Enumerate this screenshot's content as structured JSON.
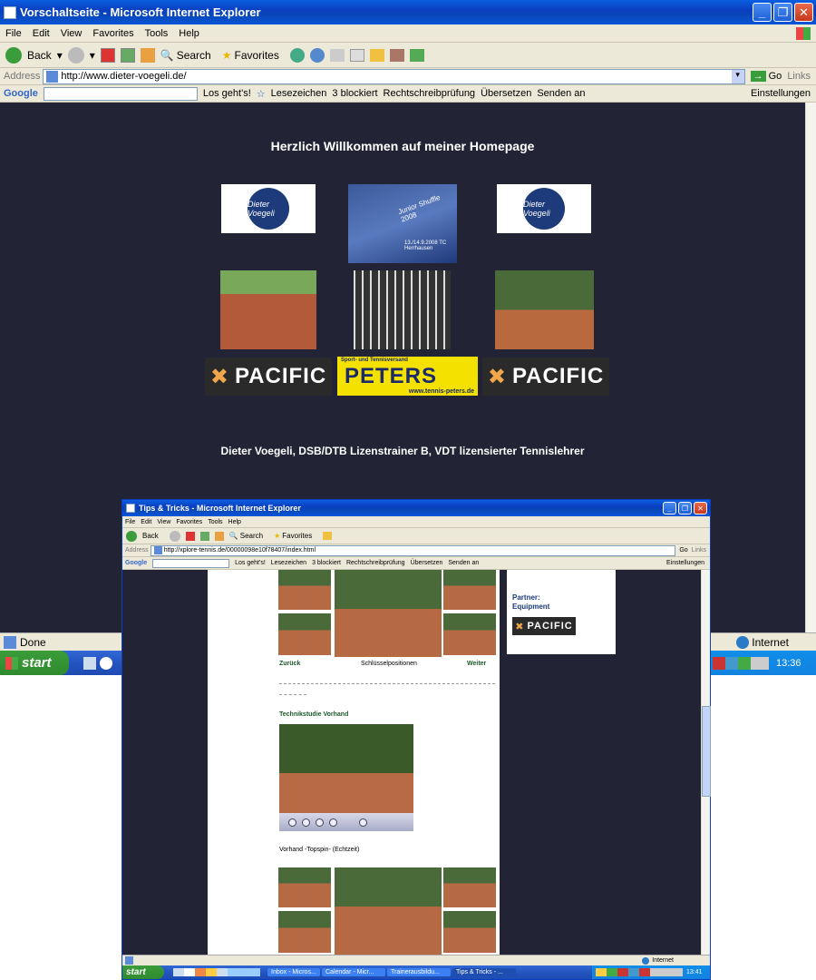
{
  "outer": {
    "title": "Vorschaltseite - Microsoft Internet Explorer",
    "menu": [
      "File",
      "Edit",
      "View",
      "Favorites",
      "Tools",
      "Help"
    ],
    "toolbar": {
      "back": "Back",
      "search": "Search",
      "favorites": "Favorites"
    },
    "address_label": "Address",
    "url": "http://www.dieter-voegeli.de/",
    "go": "Go",
    "links": "Links",
    "google": {
      "label": "Google",
      "los": "Los geht's!",
      "lesezeichen": "Lesezeichen",
      "blockiert": "3 blockiert",
      "recht": "Rechtschreibprüfung",
      "uebersetzen": "Übersetzen",
      "senden": "Senden an",
      "einstellungen": "Einstellungen"
    },
    "page": {
      "welcome": "Herzlich Willkommen auf meiner Homepage",
      "logo_text": "Dieter Voegeli",
      "junior": "Junior Shuffle 2008",
      "junior_sub": "13./14.9.2008 TC Herrhausen",
      "pacific": "PACIFIC",
      "peters_top": "Sport- und Tennisversand",
      "peters": "PETERS",
      "peters_url": "www.tennis-peters.de",
      "footer": "Dieter Voegeli, DSB/DTB Lizenstrainer B, VDT lizensierter Tennislehrer"
    },
    "status": "Done",
    "zone": "Internet",
    "start": "start",
    "clock": "13:36"
  },
  "inner": {
    "title": "Tips & Tricks - Microsoft Internet Explorer",
    "menu": [
      "File",
      "Edit",
      "View",
      "Favorites",
      "Tools",
      "Help"
    ],
    "toolbar": {
      "back": "Back",
      "search": "Search",
      "favorites": "Favorites"
    },
    "address_label": "Address",
    "url": "http://xplore-tennis.de/00000098e10f78407/index.html",
    "go": "Go",
    "links": "Links",
    "google": {
      "label": "Google",
      "los": "Los geht's!",
      "lesezeichen": "Lesezeichen",
      "blockiert": "3 blockiert",
      "recht": "Rechtschreibprüfung",
      "uebersetzen": "Übersetzen",
      "senden": "Senden an",
      "einstellungen": "Einstellungen"
    },
    "page": {
      "zurueck": "Zurück",
      "schluessel": "Schlüsselpositionen",
      "weiter": "Weiter",
      "technik": "Technikstudie Vorhand",
      "caption": "Vorhand -Topspin- (Echtzeit)",
      "partner": "Partner:",
      "equipment": "Equipment",
      "pacific": "PACIFIC"
    },
    "zone": "Internet",
    "start": "start",
    "tasks": [
      "Inbox - Micros...",
      "Calendar - Micr...",
      "Trainerausbildu...",
      "Tips & Tricks - ..."
    ],
    "clock": "13:41"
  }
}
